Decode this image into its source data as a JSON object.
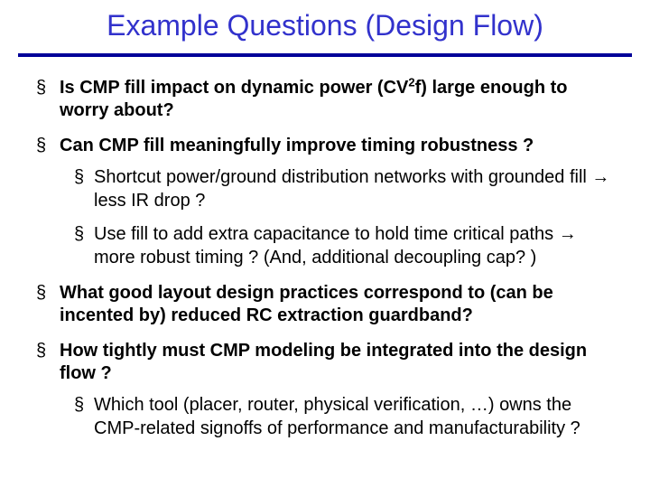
{
  "title": "Example Questions (Design Flow)",
  "bullets": {
    "b0_pre": "Is CMP fill impact on dynamic power (CV",
    "b0_sup": "2",
    "b0_post": "f) large enough to worry about?",
    "b1": "Can CMP fill meaningfully improve timing robustness ?",
    "b1_s0": "Shortcut power/ground distribution networks with grounded fill → less IR drop ?",
    "b1_s1": "Use fill to add extra capacitance to hold time critical paths → more robust timing ?    (And, additional decoupling cap? )",
    "b2": "What good layout design practices correspond to (can be incented by) reduced RC extraction guardband?",
    "b3": "How tightly must CMP modeling be integrated into the design flow ?",
    "b3_s0": "Which tool (placer, router, physical verification, …) owns the CMP-related signoffs of performance and manufacturability ?"
  }
}
